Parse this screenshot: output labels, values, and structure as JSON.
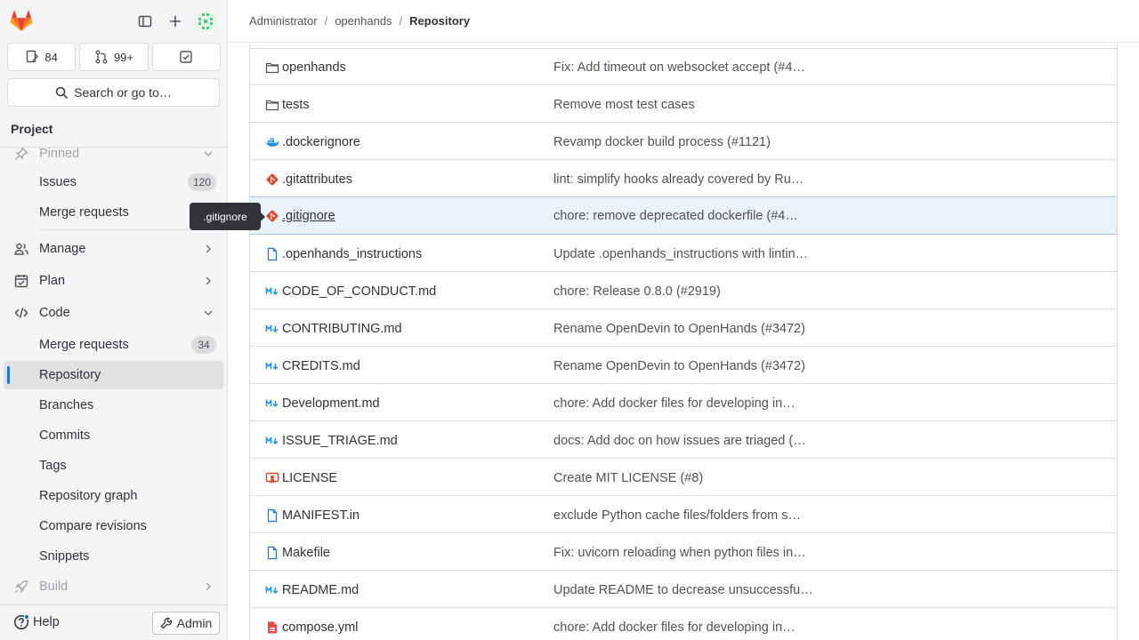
{
  "header": {
    "breadcrumbs": [
      "Administrator",
      "openhands",
      "Repository"
    ],
    "separator": "/"
  },
  "sidebar": {
    "counters": [
      {
        "icon": "issues-icon",
        "label": "84"
      },
      {
        "icon": "merge-request-icon",
        "label": "99+"
      },
      {
        "icon": "todo-icon",
        "label": ""
      }
    ],
    "search_label": "Search or go to…",
    "project_label": "Project",
    "items": [
      {
        "label": "Pinned",
        "kind": "top",
        "icon": "pin-icon",
        "faded": true
      },
      {
        "label": "Issues",
        "kind": "sub",
        "badge": "120"
      },
      {
        "label": "Merge requests",
        "kind": "sub"
      },
      {
        "label": "Manage",
        "kind": "top",
        "icon": "users-icon",
        "chevron": "right"
      },
      {
        "label": "Plan",
        "kind": "top",
        "icon": "calendar-icon",
        "chevron": "right"
      },
      {
        "label": "Code",
        "kind": "top",
        "icon": "code-icon",
        "chevron": "down"
      },
      {
        "label": "Merge requests",
        "kind": "sub",
        "badge": "34"
      },
      {
        "label": "Repository",
        "kind": "sub",
        "active": true
      },
      {
        "label": "Branches",
        "kind": "sub"
      },
      {
        "label": "Commits",
        "kind": "sub"
      },
      {
        "label": "Tags",
        "kind": "sub"
      },
      {
        "label": "Repository graph",
        "kind": "sub"
      },
      {
        "label": "Compare revisions",
        "kind": "sub"
      },
      {
        "label": "Snippets",
        "kind": "sub"
      },
      {
        "label": "Build",
        "kind": "top",
        "icon": "rocket-icon",
        "chevron": "right",
        "faded": true
      }
    ],
    "help_label": "Help",
    "admin_label": "Admin"
  },
  "tooltip": ".gitignore",
  "files": [
    {
      "name": "openhands",
      "type": "folder",
      "commit": "Fix: Add timeout on websocket accept (#4…"
    },
    {
      "name": "tests",
      "type": "folder",
      "commit": "Remove most test cases"
    },
    {
      "name": ".dockerignore",
      "type": "docker",
      "commit": "Revamp docker build process (#1121)"
    },
    {
      "name": ".gitattributes",
      "type": "git",
      "commit": "lint: simplify hooks already covered by Ru…"
    },
    {
      "name": ".gitignore",
      "type": "git",
      "commit": "chore: remove deprecated dockerfile (#4…",
      "hover": true
    },
    {
      "name": ".openhands_instructions",
      "type": "file",
      "commit": "Update .openhands_instructions with lintin…"
    },
    {
      "name": "CODE_OF_CONDUCT.md",
      "type": "markdown",
      "commit": "chore: Release 0.8.0 (#2919)"
    },
    {
      "name": "CONTRIBUTING.md",
      "type": "markdown",
      "commit": "Rename OpenDevin to OpenHands (#3472)"
    },
    {
      "name": "CREDITS.md",
      "type": "markdown",
      "commit": "Rename OpenDevin to OpenHands (#3472)"
    },
    {
      "name": "Development.md",
      "type": "markdown",
      "commit": "chore: Add docker files for developing in…"
    },
    {
      "name": "ISSUE_TRIAGE.md",
      "type": "markdown",
      "commit": "docs: Add doc on how issues are triaged (…"
    },
    {
      "name": "LICENSE",
      "type": "license",
      "commit": "Create MIT LICENSE (#8)"
    },
    {
      "name": "MANIFEST.in",
      "type": "file",
      "commit": "exclude Python cache files/folders from s…"
    },
    {
      "name": "Makefile",
      "type": "file",
      "commit": "Fix: uvicorn reloading when python files in…"
    },
    {
      "name": "README.md",
      "type": "markdown",
      "commit": "Update README to decrease unsuccessfu…"
    },
    {
      "name": "compose.yml",
      "type": "yaml",
      "commit": "chore: Add docker files for developing in…"
    }
  ],
  "colors": {
    "accent": "#1f75cb",
    "gitlab_orange": "#e24329",
    "hover_row": "#e9f3fc"
  }
}
